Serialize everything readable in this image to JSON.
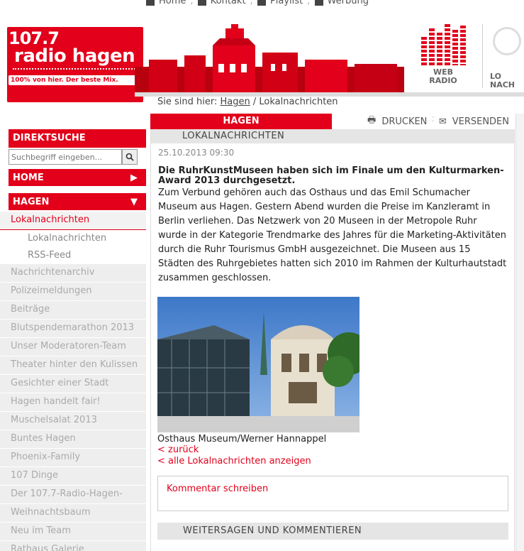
{
  "topnav": {
    "items": [
      "Home",
      "Kontakt",
      "Playlist",
      "Werbung"
    ],
    "icons": [
      "home-icon",
      "contact-icon",
      "playlist-icon",
      "advertising-icon"
    ]
  },
  "logo": {
    "freq": "107.7",
    "name": "radio hagen",
    "slogan": "100% von hier. Der beste Mix."
  },
  "header_links": {
    "webradio": [
      "WEB",
      "RADIO"
    ],
    "lokalnachrichten": [
      "LO",
      "NACH"
    ]
  },
  "breadcrumb": {
    "prefix": "Sie sind hier:",
    "link": "Hagen",
    "sep": "/",
    "current": "Lokalnachrichten"
  },
  "sidebar": {
    "search_title": "DIREKTSUCHE",
    "search_placeholder": "Suchbegriff eingeben...",
    "home": "HOME",
    "hagen": "HAGEN",
    "items": [
      {
        "label": "Lokalnachrichten",
        "type": "active"
      },
      {
        "label": "Lokalnachrichten",
        "type": "sub"
      },
      {
        "label": "RSS-Feed",
        "type": "sub"
      },
      {
        "label": "Nachrichtenarchiv",
        "type": "item"
      },
      {
        "label": "Polizeimeldungen",
        "type": "item"
      },
      {
        "label": "Beiträge",
        "type": "item"
      },
      {
        "label": "Blutspendemarathon 2013",
        "type": "item"
      },
      {
        "label": "Unser Moderatoren-Team",
        "type": "item"
      },
      {
        "label": "Theater hinter den Kulissen",
        "type": "item"
      },
      {
        "label": "Gesichter einer Stadt",
        "type": "item"
      },
      {
        "label": "Hagen handelt fair!",
        "type": "item"
      },
      {
        "label": "Muschelsalat 2013",
        "type": "item"
      },
      {
        "label": "Buntes Hagen",
        "type": "item"
      },
      {
        "label": "Phoenix-Family",
        "type": "item"
      },
      {
        "label": "107 Dinge",
        "type": "item"
      },
      {
        "label": "Der 107.7-Radio-Hagen-",
        "type": "item"
      },
      {
        "label": "Weihnachtsbaum",
        "type": "item"
      },
      {
        "label": "Neu im Team",
        "type": "item"
      },
      {
        "label": "Rathaus Galerie",
        "type": "item"
      }
    ]
  },
  "main": {
    "tab": "HAGEN",
    "print": "DRUCKEN",
    "send": "VERSENDEN",
    "section": "LOKALNACHRICHTEN",
    "datetime": "25.10.2013 09:30",
    "headline": "Die RuhrKunstMuseen haben sich im Finale um den Kulturmarken-Award 2013 durchgesetzt.",
    "body": "Zum Verbund gehören auch das Osthaus und das Emil Schumacher Museum aus Hagen. Gestern Abend wurden die Preise im Kanzleramt in Berlin verliehen. Das Netzwerk von 20 Museen in der Metropole Ruhr wurde in der Kategorie Trendmarke des Jahres für die Marketing-Aktivitäten durch die Ruhr Tourismus GmbH ausgezeichnet. Die Museen aus 15 Städten des Ruhrgebietes hatten sich 2010 im Rahmen der Kulturhautstadt zusammen geschlossen.",
    "caption": "Osthaus Museum/Werner Hannappel",
    "back": "< zurück",
    "all": "< alle Lokalnachrichten anzeigen",
    "comment": "Kommentar schreiben",
    "share": "WEITERSAGEN UND KOMMENTIEREN"
  },
  "colors": {
    "accent": "#e2001a",
    "muted": "#aaaaaa",
    "section_bg": "#e5e5e5"
  }
}
